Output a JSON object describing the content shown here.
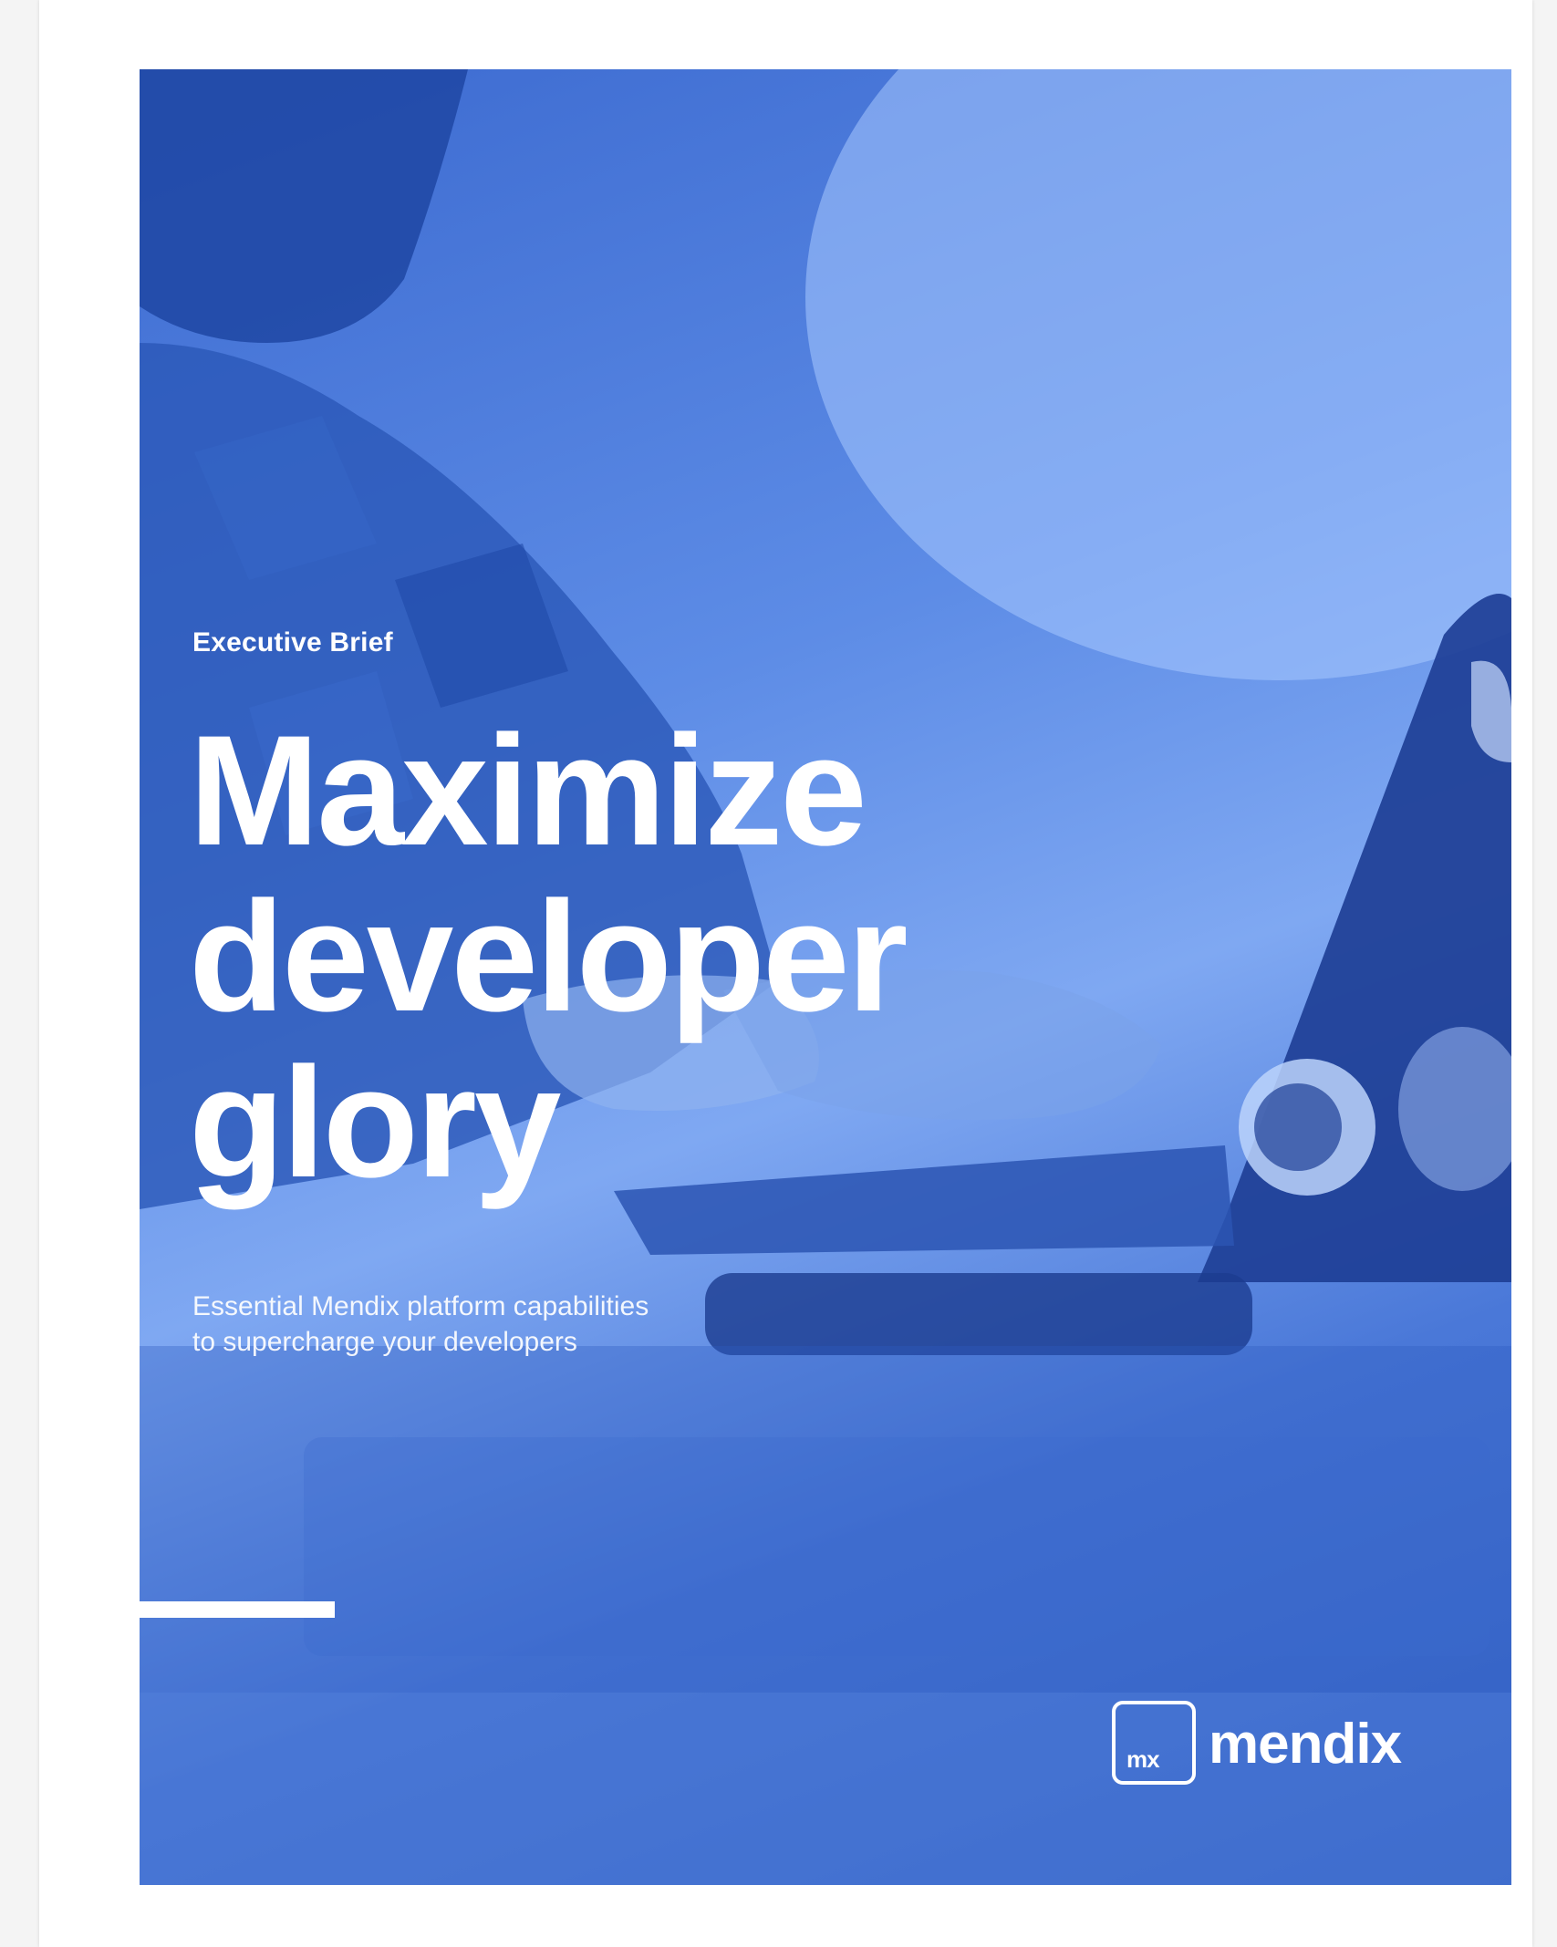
{
  "cover": {
    "kicker": "Executive Brief",
    "headline_lines": [
      "Maximize",
      "developer",
      "glory"
    ],
    "subtitle_lines": [
      "Essential Mendix platform capabilities",
      "to supercharge your developers"
    ]
  },
  "logo": {
    "mark": "mx",
    "wordmark": "mendix"
  },
  "colors": {
    "cover_tint": "#4a78d8",
    "text": "#ffffff",
    "page_background": "#f4f4f4"
  },
  "photo": {
    "icon": "person-with-laptop-photo"
  }
}
